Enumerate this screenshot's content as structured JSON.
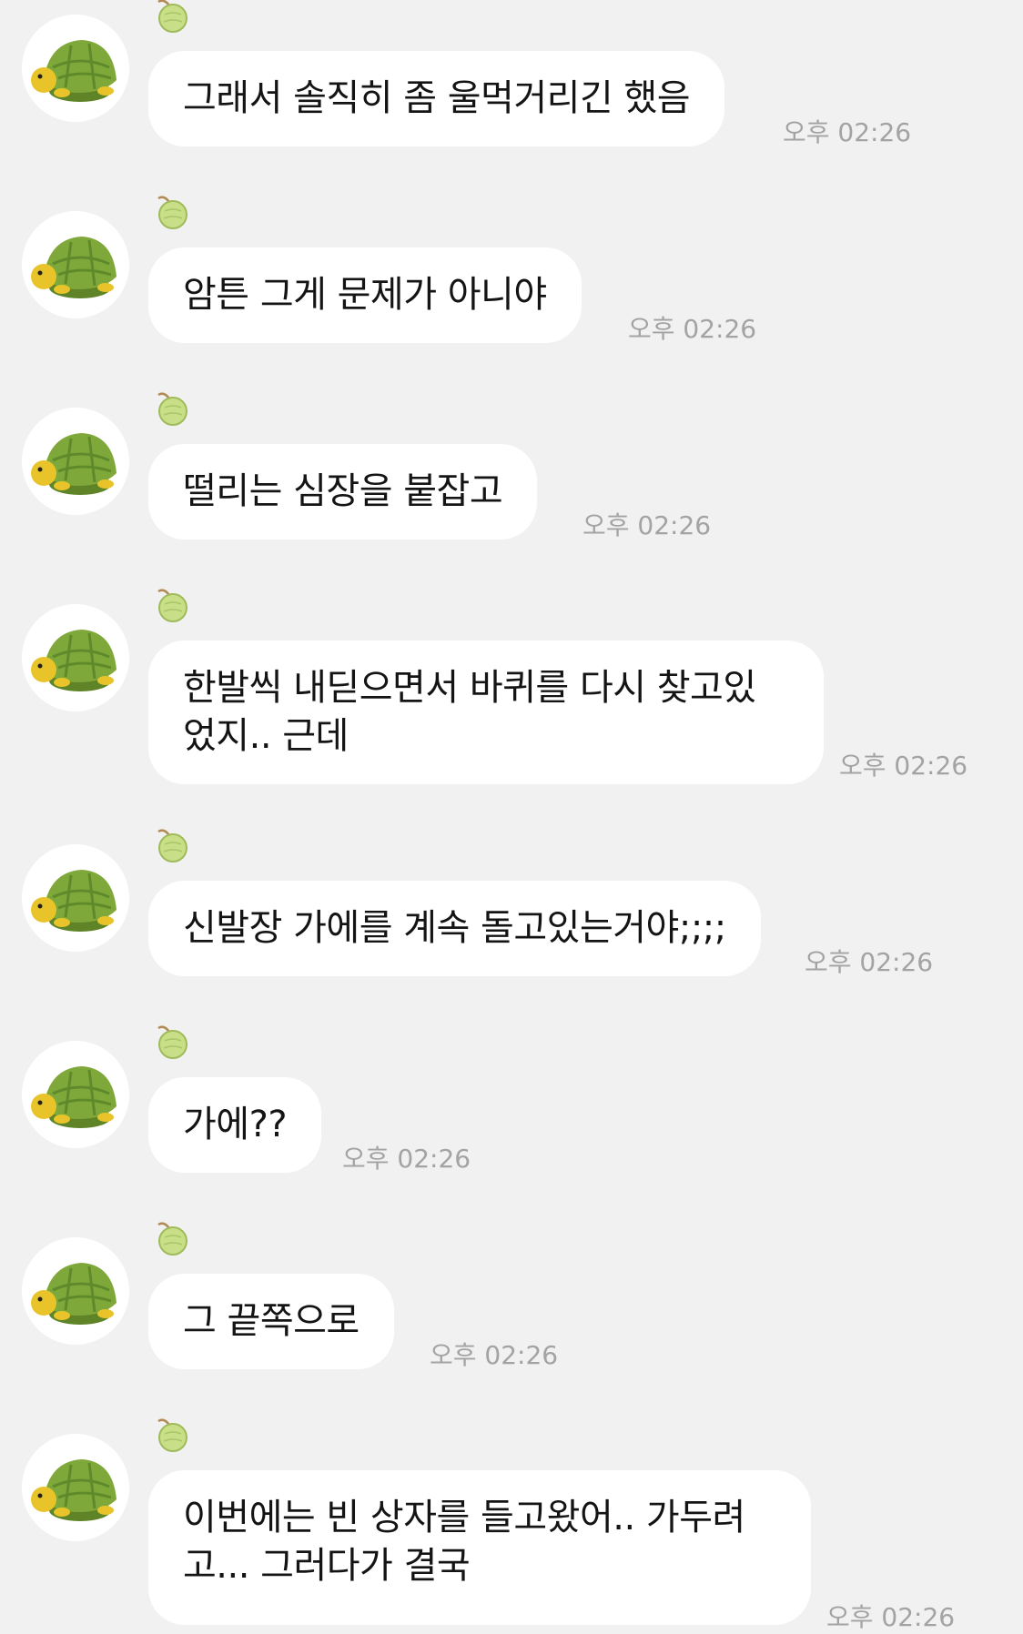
{
  "messages": [
    {
      "text": "그래서 솔직히 좀 울먹거리긴 했음",
      "time": "오후 02:26"
    },
    {
      "text": "암튼 그게 문제가 아니야",
      "time": "오후 02:26"
    },
    {
      "text": "떨리는 심장을 붙잡고",
      "time": "오후 02:26"
    },
    {
      "text": "한발씩 내딛으면서 바퀴를 다시 찾고있\n었지.. 근데",
      "time": "오후 02:26"
    },
    {
      "text": "신발장 가에를 계속 돌고있는거야;;;;",
      "time": "오후 02:26"
    },
    {
      "text": "가에??",
      "time": "오후 02:26"
    },
    {
      "text": "그 끝쪽으로",
      "time": "오후 02:26"
    },
    {
      "text": "이번에는 빈 상자를 들고왔어.. 가두려\n고... 그러다가 결국",
      "time": "오후 02:26"
    }
  ],
  "avatar_icon": "turtle-melon-avatar-icon",
  "name_icon": "melon-icon",
  "colors": {
    "background": "#f1f1f1",
    "bubble": "#ffffff",
    "text": "#141414",
    "time": "#a3a3a3",
    "turtle_shell": "#7fa83a",
    "turtle_skin": "#e8c42a"
  }
}
